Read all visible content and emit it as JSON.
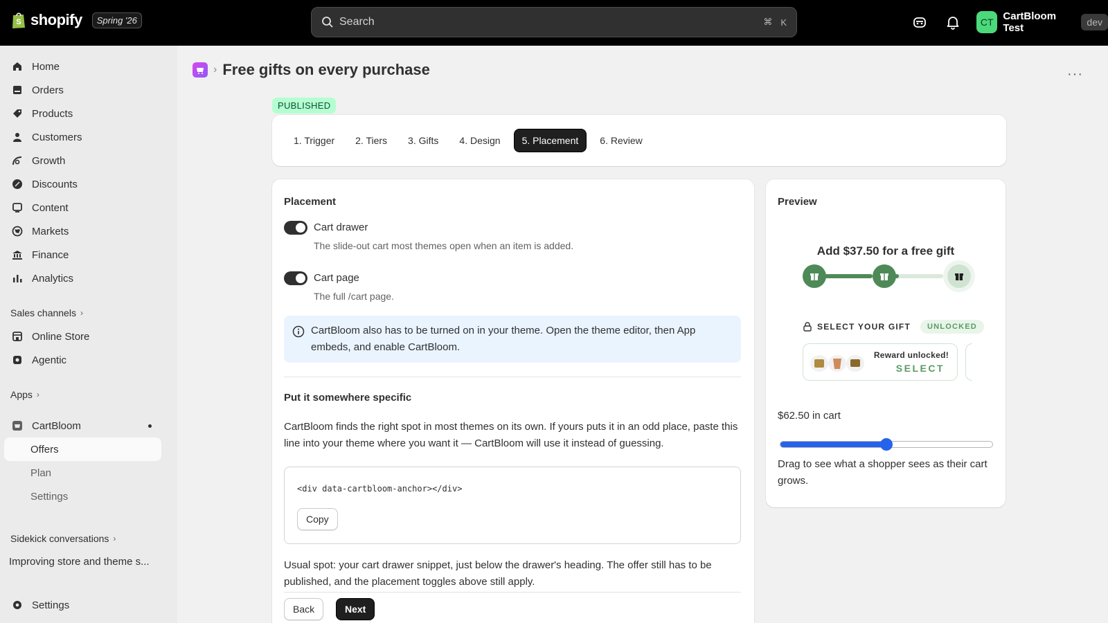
{
  "topbar": {
    "logo_text": "shopify",
    "edition": "Spring '26",
    "search_placeholder": "Search",
    "shortcut_cmd": "⌘",
    "shortcut_key": "K",
    "account_initials": "CT",
    "account_name": "CartBloom Test",
    "account_badge": "dev"
  },
  "sidebar": {
    "items": [
      {
        "label": "Home",
        "icon": "home-icon"
      },
      {
        "label": "Orders",
        "icon": "orders-icon"
      },
      {
        "label": "Products",
        "icon": "tag-icon"
      },
      {
        "label": "Customers",
        "icon": "person-icon"
      },
      {
        "label": "Growth",
        "icon": "growth-icon"
      },
      {
        "label": "Discounts",
        "icon": "discount-icon"
      },
      {
        "label": "Content",
        "icon": "content-icon"
      },
      {
        "label": "Markets",
        "icon": "globe-icon"
      },
      {
        "label": "Finance",
        "icon": "bank-icon"
      },
      {
        "label": "Analytics",
        "icon": "chart-icon"
      }
    ],
    "sales_channels_label": "Sales channels",
    "channels": [
      {
        "label": "Online Store",
        "icon": "store-icon"
      },
      {
        "label": "Agentic",
        "icon": "agentic-icon"
      }
    ],
    "apps_label": "Apps",
    "app_name": "CartBloom",
    "app_subitems": [
      "Offers",
      "Plan",
      "Settings"
    ],
    "sidekick_label": "Sidekick conversations",
    "sidekick_item": "Improving store and theme s...",
    "settings_label": "Settings"
  },
  "page": {
    "title": "Free gifts on every purchase",
    "more_label": "···",
    "status_badge": "PUBLISHED",
    "steps": [
      "1. Trigger",
      "2. Tiers",
      "3. Gifts",
      "4. Design",
      "5. Placement",
      "6. Review"
    ],
    "active_step": 4
  },
  "placement": {
    "title": "Placement",
    "cart_drawer_label": "Cart drawer",
    "cart_drawer_help": "The slide-out cart most themes open when an item is added.",
    "cart_page_label": "Cart page",
    "cart_page_help": "The full /cart page.",
    "banner_text": "CartBloom also has to be turned on in your theme. Open the theme editor, then App embeds, and enable CartBloom.",
    "specific_title": "Put it somewhere specific",
    "specific_text": "CartBloom finds the right spot in most themes on its own. If yours puts it in an odd place, paste this line into your theme where you want it — CartBloom will use it instead of guessing.",
    "code": "<div data-cartbloom-anchor></div>",
    "copy_label": "Copy",
    "usual_text": "Usual spot: your cart drawer snippet, just below the drawer's heading. The offer still has to be published, and the placement toggles above still apply.",
    "back_label": "Back",
    "next_label": "Next"
  },
  "preview": {
    "title": "Preview",
    "headline": "Add $37.50 for a free gift",
    "select_label": "SELECT YOUR GIFT",
    "unlocked_label": "UNLOCKED",
    "reward_text": "Reward unlocked!",
    "select_button": "SELECT",
    "cart_amount": "$62.50 in cart",
    "slider_fraction": 0.5,
    "help": "Drag to see what a shopper sees as their cart grows."
  },
  "colors": {
    "accent_green": "#5a9a63",
    "slider_blue": "#2563eb",
    "published_bg": "#b4fed2",
    "banner_bg": "#eaf4ff"
  }
}
